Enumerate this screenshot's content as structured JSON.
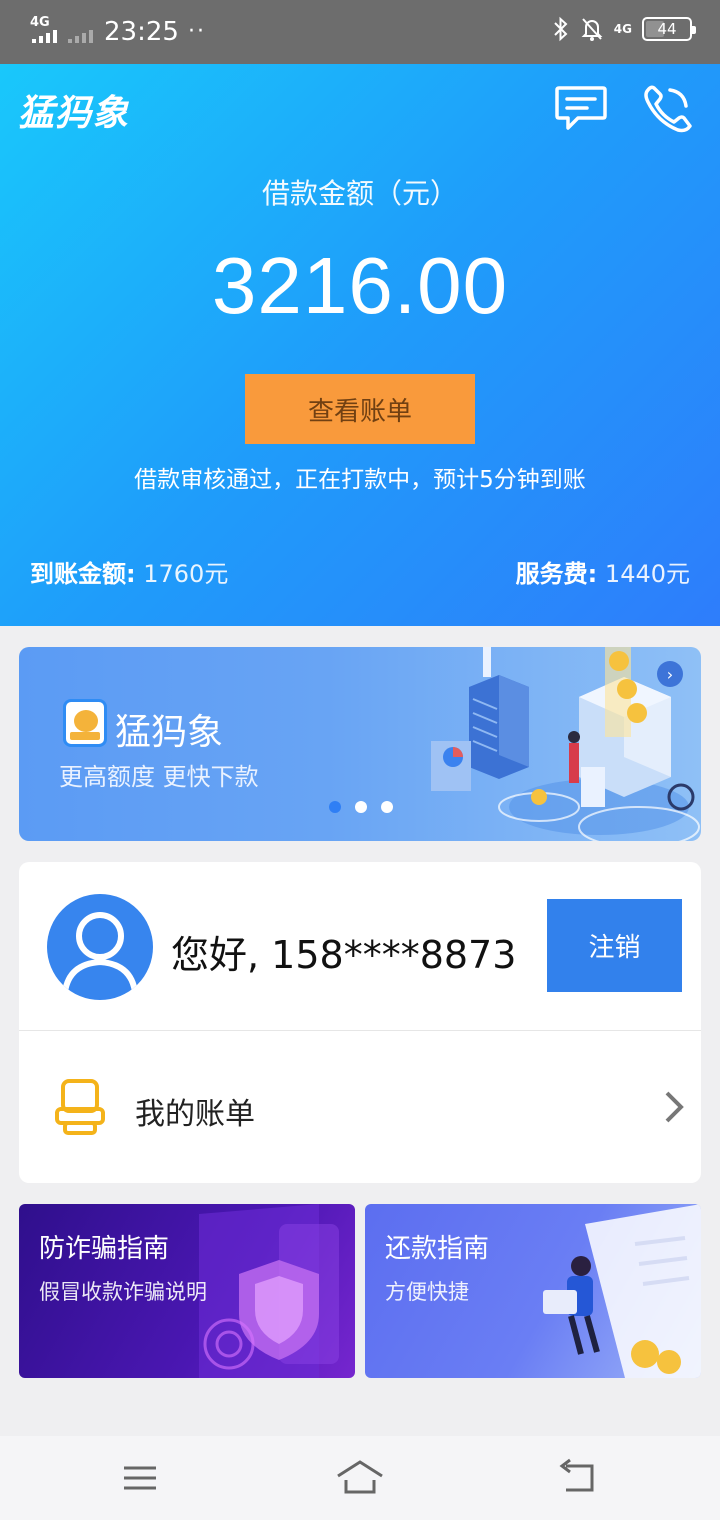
{
  "status_bar": {
    "network": "4G",
    "time": "23:25",
    "dots": "··",
    "right_network": "4G",
    "battery": "44"
  },
  "header": {
    "logo": "猛犸象",
    "icons": [
      "message-icon",
      "phone-icon"
    ]
  },
  "loan": {
    "label": "借款金额（元）",
    "amount": "3216.00",
    "view_bill_button": "查看账单",
    "status_text": "借款审核通过，正在打款中，预计5分钟到账",
    "received_label": "到账金额:",
    "received_value": "1760元",
    "fee_label": "服务费:",
    "fee_value": "1440元"
  },
  "banner": {
    "title": "猛犸象",
    "subtitle": "更高额度 更快下款",
    "pages": 3,
    "active_page": 1
  },
  "user": {
    "greeting": "您好, 158****8873",
    "logout_button": "注销",
    "my_bill_label": "我的账单"
  },
  "cards": [
    {
      "title": "防诈骗指南",
      "subtitle": "假冒收款诈骗说明"
    },
    {
      "title": "还款指南",
      "subtitle": "方便快捷"
    }
  ],
  "colors": {
    "accent": "#2f7ff5",
    "hero_start": "#19c8fb",
    "hero_end": "#2e7dfb",
    "button_orange": "#f99a3c",
    "logout_blue": "#3281ec"
  }
}
